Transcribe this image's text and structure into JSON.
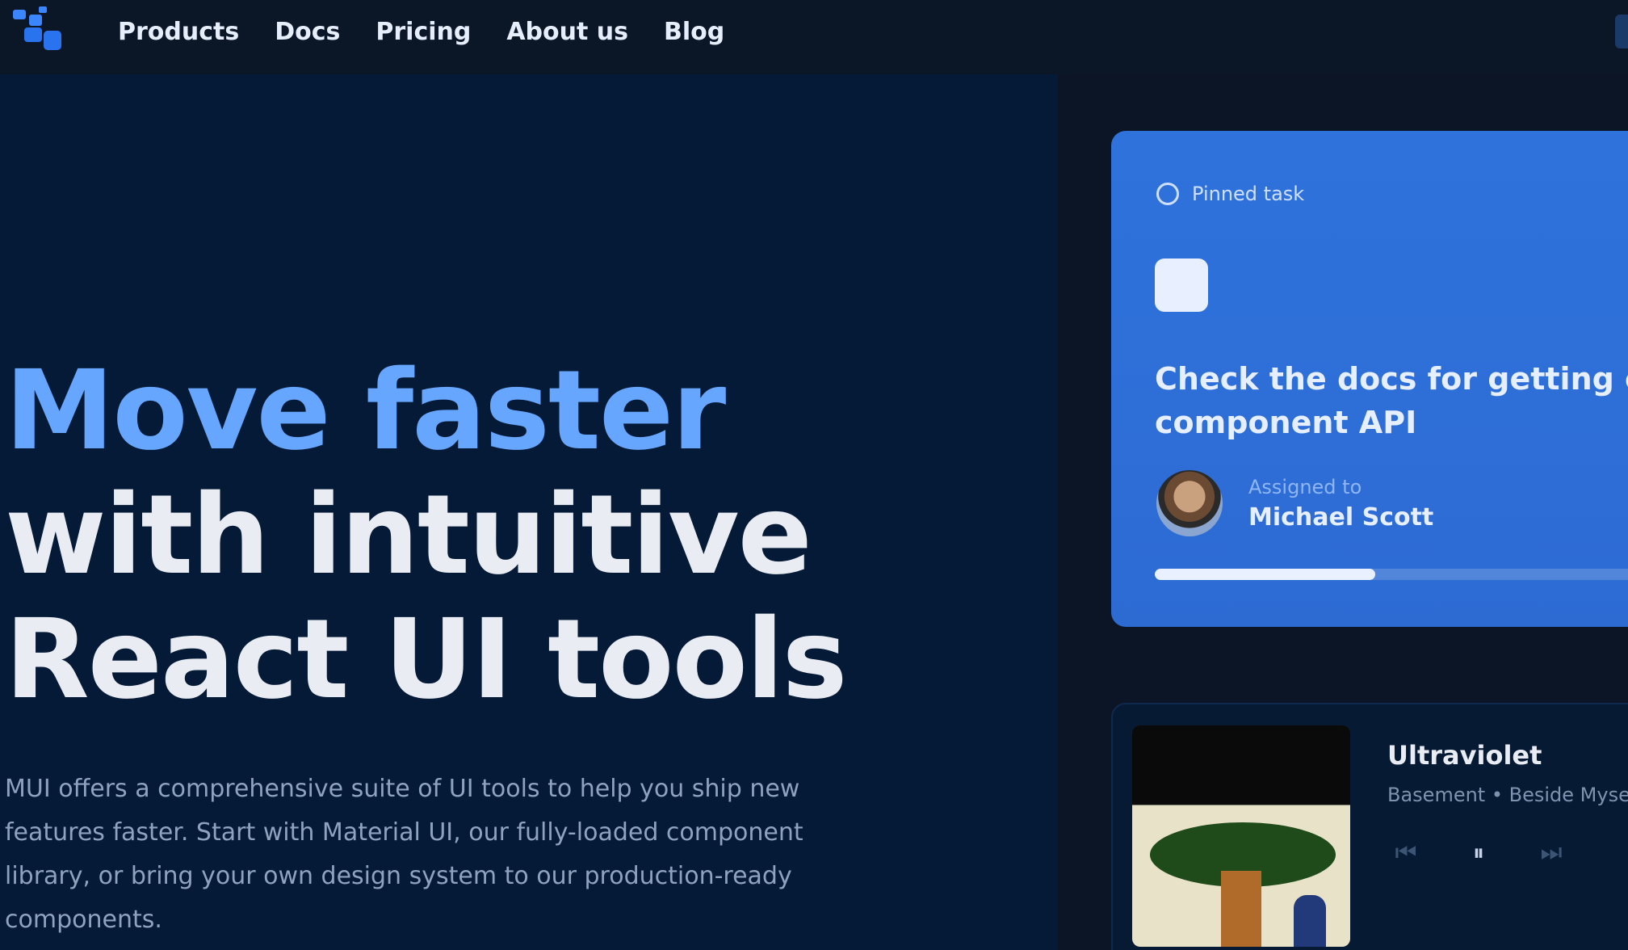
{
  "nav": {
    "logo_name": "mui-logo",
    "links": [
      "Products",
      "Docs",
      "Pricing",
      "About us",
      "Blog"
    ]
  },
  "hero": {
    "title_line1": "Move faster",
    "title_line2": "with intuitive",
    "title_line3": "React UI tools",
    "description": "MUI offers a comprehensive suite of UI tools to help you ship new features faster. Start with Material UI, our fully-loaded component library, or bring your own design system to our production-ready components."
  },
  "task_card": {
    "header": "Pinned task",
    "text_line1": "Check the docs for getting every",
    "text_line2": "component API",
    "assignee_label": "Assigned to",
    "assignee_name": "Michael Scott",
    "progress": 0.45
  },
  "player_card": {
    "album_text": "",
    "title": "Ultraviolet",
    "subtitle": "Basement • Beside Myself",
    "controls": {
      "prev": "⏮",
      "play": "⏸",
      "next": "⏭"
    }
  },
  "colors": {
    "accent": "#66a6ff",
    "card_blue": "#2f72dc",
    "background": "#051a36"
  }
}
